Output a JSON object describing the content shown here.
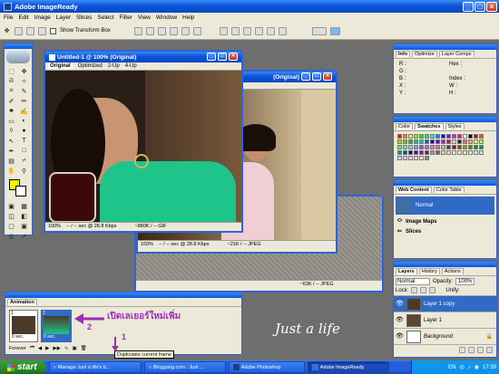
{
  "app": {
    "title": "Adobe ImageReady"
  },
  "menu": [
    "File",
    "Edit",
    "Image",
    "Layer",
    "Slices",
    "Select",
    "Filter",
    "View",
    "Window",
    "Help"
  ],
  "options": {
    "show_transform": "Show Transform Box"
  },
  "doc1": {
    "title": "Untitled-1 @ 100% (Original)",
    "tabs": [
      "Original",
      "Optimized",
      "2-Up",
      "4-Up"
    ],
    "zoom": "100%",
    "speed": "-- / -- sec @ 28.8 Kbps",
    "info": "~880K / -- GIF"
  },
  "doc2": {
    "title": "(Original)",
    "zoom": "100%",
    "speed": "-- / -- sec @ 28.8 Kbps",
    "info": "~21K / -- JPEG"
  },
  "doc3": {
    "info": "~63K / -- JPEG"
  },
  "info_palette": {
    "tabs": [
      "Info",
      "Optimize",
      "Layer Comps"
    ],
    "rows": [
      {
        "a": "R :",
        "b": "Hex :"
      },
      {
        "a": "G :",
        "b": ""
      },
      {
        "a": "B :",
        "b": "Index :"
      },
      {
        "a": "X :",
        "b": "W :"
      },
      {
        "a": "Y :",
        "b": "H :"
      }
    ]
  },
  "swatch_palette": {
    "tabs": [
      "Color",
      "Swatches",
      "Styles"
    ]
  },
  "web_palette": {
    "tabs": [
      "Web Content",
      "Color Table"
    ],
    "items": [
      "Normal",
      "Image Maps",
      "Slices"
    ]
  },
  "layers_palette": {
    "tabs": [
      "Layers",
      "History",
      "Actions"
    ],
    "blend": "Normal",
    "opacity_label": "Opacity:",
    "opacity": "100%",
    "lock_label": "Lock:",
    "unify_label": "Unify:",
    "layers": [
      "Layer 1 copy",
      "Layer 1",
      "Background"
    ]
  },
  "animation": {
    "title": "Animation",
    "frames": [
      {
        "n": "1",
        "delay": "0 sec."
      },
      {
        "n": "2",
        "delay": "0 sec."
      }
    ],
    "loop": "Forever",
    "tooltip": "Duplicates current frame"
  },
  "annotation": {
    "thai": "เปิดเลเยอร์ใหม่เพิ่ม",
    "num1": "1",
    "num2": "2"
  },
  "watermark": "Just a life",
  "taskbar": {
    "start": "start",
    "tasks": [
      "Manage Just a life's b...",
      "Bloggang.com : Just ...",
      "Adobe Photoshop",
      "Adobe ImageReady"
    ],
    "lang": "EN",
    "clock": "17:39"
  },
  "colors": {
    "accent": "#0a55d6",
    "annotation": "#9b2fb5",
    "layer_selected": "#316ac5"
  }
}
